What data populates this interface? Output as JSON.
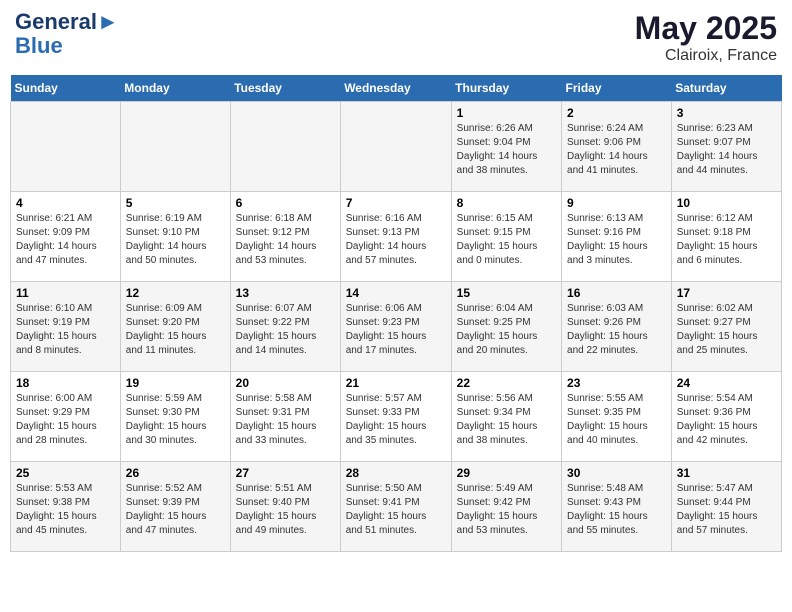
{
  "header": {
    "logo_line1": "General",
    "logo_line2": "Blue",
    "title": "May 2025",
    "subtitle": "Clairoix, France"
  },
  "weekdays": [
    "Sunday",
    "Monday",
    "Tuesday",
    "Wednesday",
    "Thursday",
    "Friday",
    "Saturday"
  ],
  "weeks": [
    [
      {
        "day": "",
        "info": ""
      },
      {
        "day": "",
        "info": ""
      },
      {
        "day": "",
        "info": ""
      },
      {
        "day": "",
        "info": ""
      },
      {
        "day": "1",
        "info": "Sunrise: 6:26 AM\nSunset: 9:04 PM\nDaylight: 14 hours and 38 minutes."
      },
      {
        "day": "2",
        "info": "Sunrise: 6:24 AM\nSunset: 9:06 PM\nDaylight: 14 hours and 41 minutes."
      },
      {
        "day": "3",
        "info": "Sunrise: 6:23 AM\nSunset: 9:07 PM\nDaylight: 14 hours and 44 minutes."
      }
    ],
    [
      {
        "day": "4",
        "info": "Sunrise: 6:21 AM\nSunset: 9:09 PM\nDaylight: 14 hours and 47 minutes."
      },
      {
        "day": "5",
        "info": "Sunrise: 6:19 AM\nSunset: 9:10 PM\nDaylight: 14 hours and 50 minutes."
      },
      {
        "day": "6",
        "info": "Sunrise: 6:18 AM\nSunset: 9:12 PM\nDaylight: 14 hours and 53 minutes."
      },
      {
        "day": "7",
        "info": "Sunrise: 6:16 AM\nSunset: 9:13 PM\nDaylight: 14 hours and 57 minutes."
      },
      {
        "day": "8",
        "info": "Sunrise: 6:15 AM\nSunset: 9:15 PM\nDaylight: 15 hours and 0 minutes."
      },
      {
        "day": "9",
        "info": "Sunrise: 6:13 AM\nSunset: 9:16 PM\nDaylight: 15 hours and 3 minutes."
      },
      {
        "day": "10",
        "info": "Sunrise: 6:12 AM\nSunset: 9:18 PM\nDaylight: 15 hours and 6 minutes."
      }
    ],
    [
      {
        "day": "11",
        "info": "Sunrise: 6:10 AM\nSunset: 9:19 PM\nDaylight: 15 hours and 8 minutes."
      },
      {
        "day": "12",
        "info": "Sunrise: 6:09 AM\nSunset: 9:20 PM\nDaylight: 15 hours and 11 minutes."
      },
      {
        "day": "13",
        "info": "Sunrise: 6:07 AM\nSunset: 9:22 PM\nDaylight: 15 hours and 14 minutes."
      },
      {
        "day": "14",
        "info": "Sunrise: 6:06 AM\nSunset: 9:23 PM\nDaylight: 15 hours and 17 minutes."
      },
      {
        "day": "15",
        "info": "Sunrise: 6:04 AM\nSunset: 9:25 PM\nDaylight: 15 hours and 20 minutes."
      },
      {
        "day": "16",
        "info": "Sunrise: 6:03 AM\nSunset: 9:26 PM\nDaylight: 15 hours and 22 minutes."
      },
      {
        "day": "17",
        "info": "Sunrise: 6:02 AM\nSunset: 9:27 PM\nDaylight: 15 hours and 25 minutes."
      }
    ],
    [
      {
        "day": "18",
        "info": "Sunrise: 6:00 AM\nSunset: 9:29 PM\nDaylight: 15 hours and 28 minutes."
      },
      {
        "day": "19",
        "info": "Sunrise: 5:59 AM\nSunset: 9:30 PM\nDaylight: 15 hours and 30 minutes."
      },
      {
        "day": "20",
        "info": "Sunrise: 5:58 AM\nSunset: 9:31 PM\nDaylight: 15 hours and 33 minutes."
      },
      {
        "day": "21",
        "info": "Sunrise: 5:57 AM\nSunset: 9:33 PM\nDaylight: 15 hours and 35 minutes."
      },
      {
        "day": "22",
        "info": "Sunrise: 5:56 AM\nSunset: 9:34 PM\nDaylight: 15 hours and 38 minutes."
      },
      {
        "day": "23",
        "info": "Sunrise: 5:55 AM\nSunset: 9:35 PM\nDaylight: 15 hours and 40 minutes."
      },
      {
        "day": "24",
        "info": "Sunrise: 5:54 AM\nSunset: 9:36 PM\nDaylight: 15 hours and 42 minutes."
      }
    ],
    [
      {
        "day": "25",
        "info": "Sunrise: 5:53 AM\nSunset: 9:38 PM\nDaylight: 15 hours and 45 minutes."
      },
      {
        "day": "26",
        "info": "Sunrise: 5:52 AM\nSunset: 9:39 PM\nDaylight: 15 hours and 47 minutes."
      },
      {
        "day": "27",
        "info": "Sunrise: 5:51 AM\nSunset: 9:40 PM\nDaylight: 15 hours and 49 minutes."
      },
      {
        "day": "28",
        "info": "Sunrise: 5:50 AM\nSunset: 9:41 PM\nDaylight: 15 hours and 51 minutes."
      },
      {
        "day": "29",
        "info": "Sunrise: 5:49 AM\nSunset: 9:42 PM\nDaylight: 15 hours and 53 minutes."
      },
      {
        "day": "30",
        "info": "Sunrise: 5:48 AM\nSunset: 9:43 PM\nDaylight: 15 hours and 55 minutes."
      },
      {
        "day": "31",
        "info": "Sunrise: 5:47 AM\nSunset: 9:44 PM\nDaylight: 15 hours and 57 minutes."
      }
    ]
  ]
}
